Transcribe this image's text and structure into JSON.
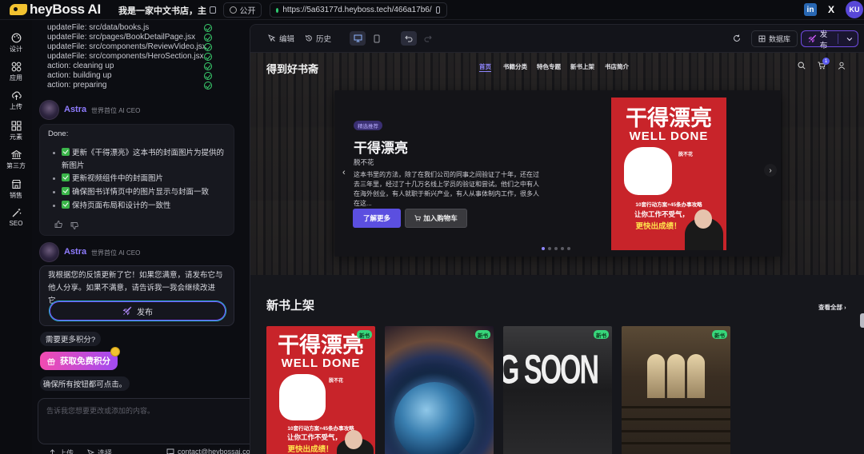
{
  "app": {
    "logo_text": "heyBoss AI",
    "project_title": "我是一家中文书店，主",
    "visibility_label": "公开",
    "url": "https://5a63177d.heyboss.tech/466a17b6/",
    "social": [
      "in",
      "X"
    ],
    "user_initials": "KU"
  },
  "leftnav": {
    "items": [
      {
        "label": "设计",
        "icon": "palette-icon"
      },
      {
        "label": "应用",
        "icon": "apps-icon"
      },
      {
        "label": "上传",
        "icon": "cloud-upload-icon"
      },
      {
        "label": "元素",
        "icon": "grid-icon"
      },
      {
        "label": "第三方",
        "icon": "bank-icon"
      },
      {
        "label": "销售",
        "icon": "store-icon"
      },
      {
        "label": "SEO",
        "icon": "wand-icon"
      }
    ]
  },
  "chat": {
    "log": [
      "updateFile: src/data/books.js",
      "updateFile: src/pages/BookDetailPage.jsx",
      "updateFile: src/components/ReviewVideo.jsx",
      "updateFile: src/components/HeroSection.jsx",
      "action: cleaning up",
      "action: building up",
      "action: preparing"
    ],
    "agent_name": "Astra",
    "agent_role": "世界首位 AI CEO",
    "message1": {
      "intro": "Done:",
      "items": [
        "更新《干得漂亮》这本书的封面图片为提供的新图片",
        "更新视频组件中的封面图片",
        "确保图书详情页中的图片显示与封面一致",
        "保持页面布局和设计的一致性"
      ]
    },
    "message2": {
      "text": "我根据您的反馈更新了它！如果您满意，请发布它与他人分享。如果不满意，请告诉我一我会继续改进它。",
      "publish_label": "发布"
    },
    "need_credits": "需要更多积分?",
    "free_credits": "获取免费积分",
    "ensure_text": "确保所有按钮都可点击。",
    "input_placeholder": "告诉我您想要更改或添加的内容。",
    "footer": {
      "upload": "上传",
      "select": "选择",
      "contact": "contact@heybossai.com"
    }
  },
  "preview_toolbar": {
    "edit": "编辑",
    "history": "历史",
    "database": "数据库",
    "publish": "发布"
  },
  "site": {
    "brand": "得到好书斋",
    "nav": [
      "首页",
      "书籍分类",
      "特色专题",
      "新书上架",
      "书店简介"
    ],
    "cart_count": "1",
    "hero": {
      "tag": "精选推荐",
      "title": "干得漂亮",
      "author": "脱不花",
      "description": "这本书里的方法，除了在我们公司的同事之间验证了十年，还在过去三年里，经过了十几万名线上学员的验证和尝试。他们之中有人在海外创业，有人就职于新兴产业，有人从事体制内工作，很多人在这...",
      "learn_more": "了解更多",
      "add_to_cart": "加入购物车",
      "slide_count": 5,
      "active_slide": 0
    },
    "cover": {
      "title": "干得漂亮",
      "subtitle": "WELL DONE",
      "author": "脱不花",
      "tag_line": "10套行动方案+45条办事攻略",
      "slogan1": "让你工作不受气，",
      "slogan2": "更快出成绩！"
    },
    "new_books": {
      "title": "新书上架",
      "see_all": "查看全部",
      "badge": "新书",
      "soon_text": "G SOON"
    }
  },
  "colors": {
    "accent": "#5b4fe0",
    "book_red": "#c8242a",
    "new_badge": "#37d67a"
  }
}
